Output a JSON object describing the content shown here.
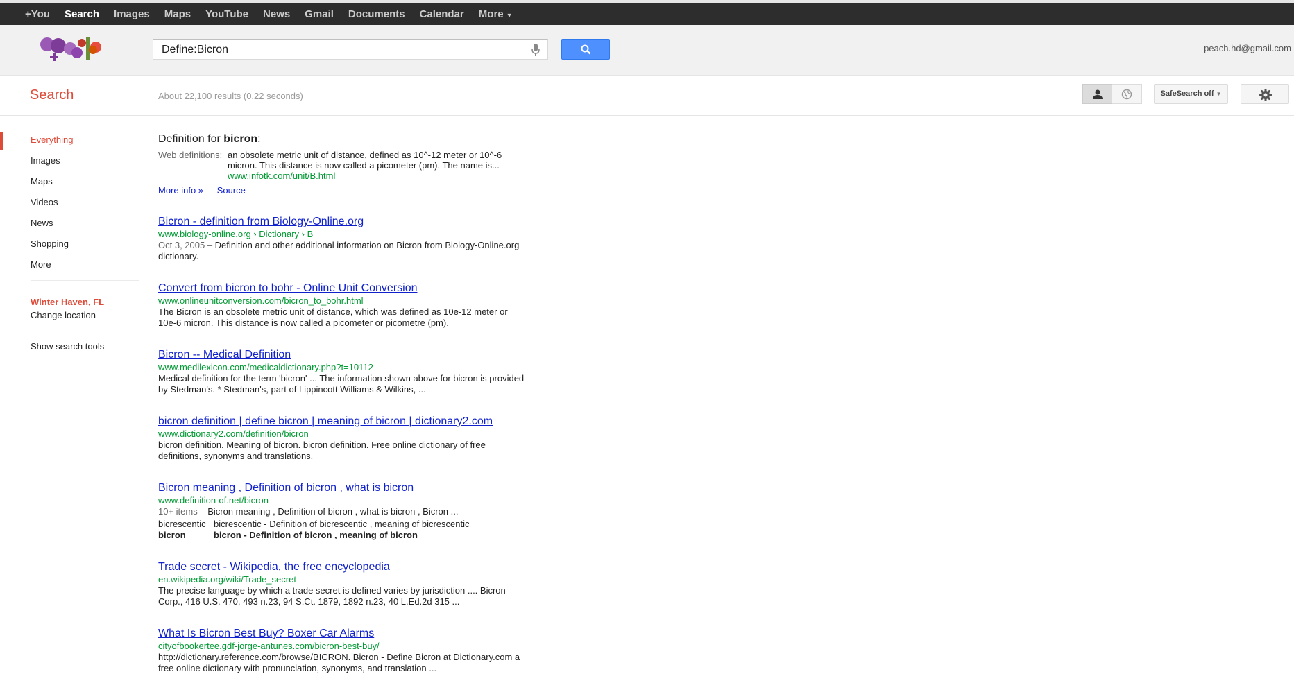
{
  "topnav": {
    "items": [
      "+You",
      "Search",
      "Images",
      "Maps",
      "YouTube",
      "News",
      "Gmail",
      "Documents",
      "Calendar",
      "More"
    ]
  },
  "header": {
    "search_query": "Define:Bicron",
    "account": "peach.hd@gmail.com"
  },
  "subheader": {
    "title": "Search",
    "stats": "About 22,100 results (0.22 seconds)",
    "safesearch": "SafeSearch off"
  },
  "leftnav": {
    "items": [
      "Everything",
      "Images",
      "Maps",
      "Videos",
      "News",
      "Shopping",
      "More"
    ],
    "location_city": "Winter Haven, FL",
    "change_location": "Change location",
    "show_tools": "Show search tools"
  },
  "definition": {
    "title_prefix": "Definition for ",
    "title_word": "bicron",
    "title_suffix": ":",
    "label": "Web definitions:",
    "text": "an obsolete metric unit of distance, defined as 10^-12 meter or 10^-6 micron. This distance is now called a picometer (pm). The name is...",
    "url": "www.infotk.com/unit/B.html",
    "more_info": "More info »",
    "source": "Source"
  },
  "results": [
    {
      "title": "Bicron - definition from Biology-Online.org",
      "url": "www.biology-online.org › Dictionary › B",
      "date": "Oct 3, 2005 – ",
      "snippet": "Definition and other additional information on Bicron from Biology-Online.org dictionary."
    },
    {
      "title": "Convert from bicron to bohr - Online Unit Conversion",
      "url": "www.onlineunitconversion.com/bicron_to_bohr.html",
      "snippet": "The Bicron is an obsolete metric unit of distance, which was defined as 10e-12 meter or 10e-6 micron. This distance is now called a picometer or picometre (pm)."
    },
    {
      "title": "Bicron -- Medical Definition",
      "url": "www.medilexicon.com/medicaldictionary.php?t=10112",
      "snippet": "Medical definition for the term 'bicron' ... The information shown above for bicron is provided by Stedman's. * Stedman's, part of Lippincott Williams & Wilkins, ..."
    },
    {
      "title": "bicron definition | define bicron | meaning of bicron | dictionary2.com",
      "url": "www.dictionary2.com/definition/bicron",
      "snippet": "bicron definition. Meaning of bicron. bicron definition. Free online dictionary of free definitions, synonyms and translations."
    },
    {
      "title": "Bicron meaning , Definition of bicron , what is bicron",
      "url": "www.definition-of.net/bicron",
      "date": "10+ items – ",
      "snippet": "Bicron meaning , Definition of bicron , what is bicron , Bicron ...",
      "table": [
        {
          "c1": "bicrescentic",
          "c2": "bicrescentic - Definition of bicrescentic , meaning of bicrescentic"
        },
        {
          "c1": "bicron",
          "c2": "bicron - Definition of bicron , meaning of bicron"
        }
      ]
    },
    {
      "title": "Trade secret - Wikipedia, the free encyclopedia",
      "url": "en.wikipedia.org/wiki/Trade_secret",
      "snippet": "The precise language by which a trade secret is defined varies by jurisdiction .... Bicron Corp., 416 U.S. 470, 493 n.23, 94 S.Ct. 1879, 1892 n.23, 40 L.Ed.2d 315 ..."
    },
    {
      "title": "What Is Bicron Best Buy? Boxer Car Alarms",
      "url": "cityofbookertee.gdf-jorge-antunes.com/bicron-best-buy/",
      "snippet": "http://dictionary.reference.com/browse/BICRON. Bicron - Define Bicron at Dictionary.com a free online dictionary with pronunciation, synonyms, and translation ..."
    }
  ]
}
